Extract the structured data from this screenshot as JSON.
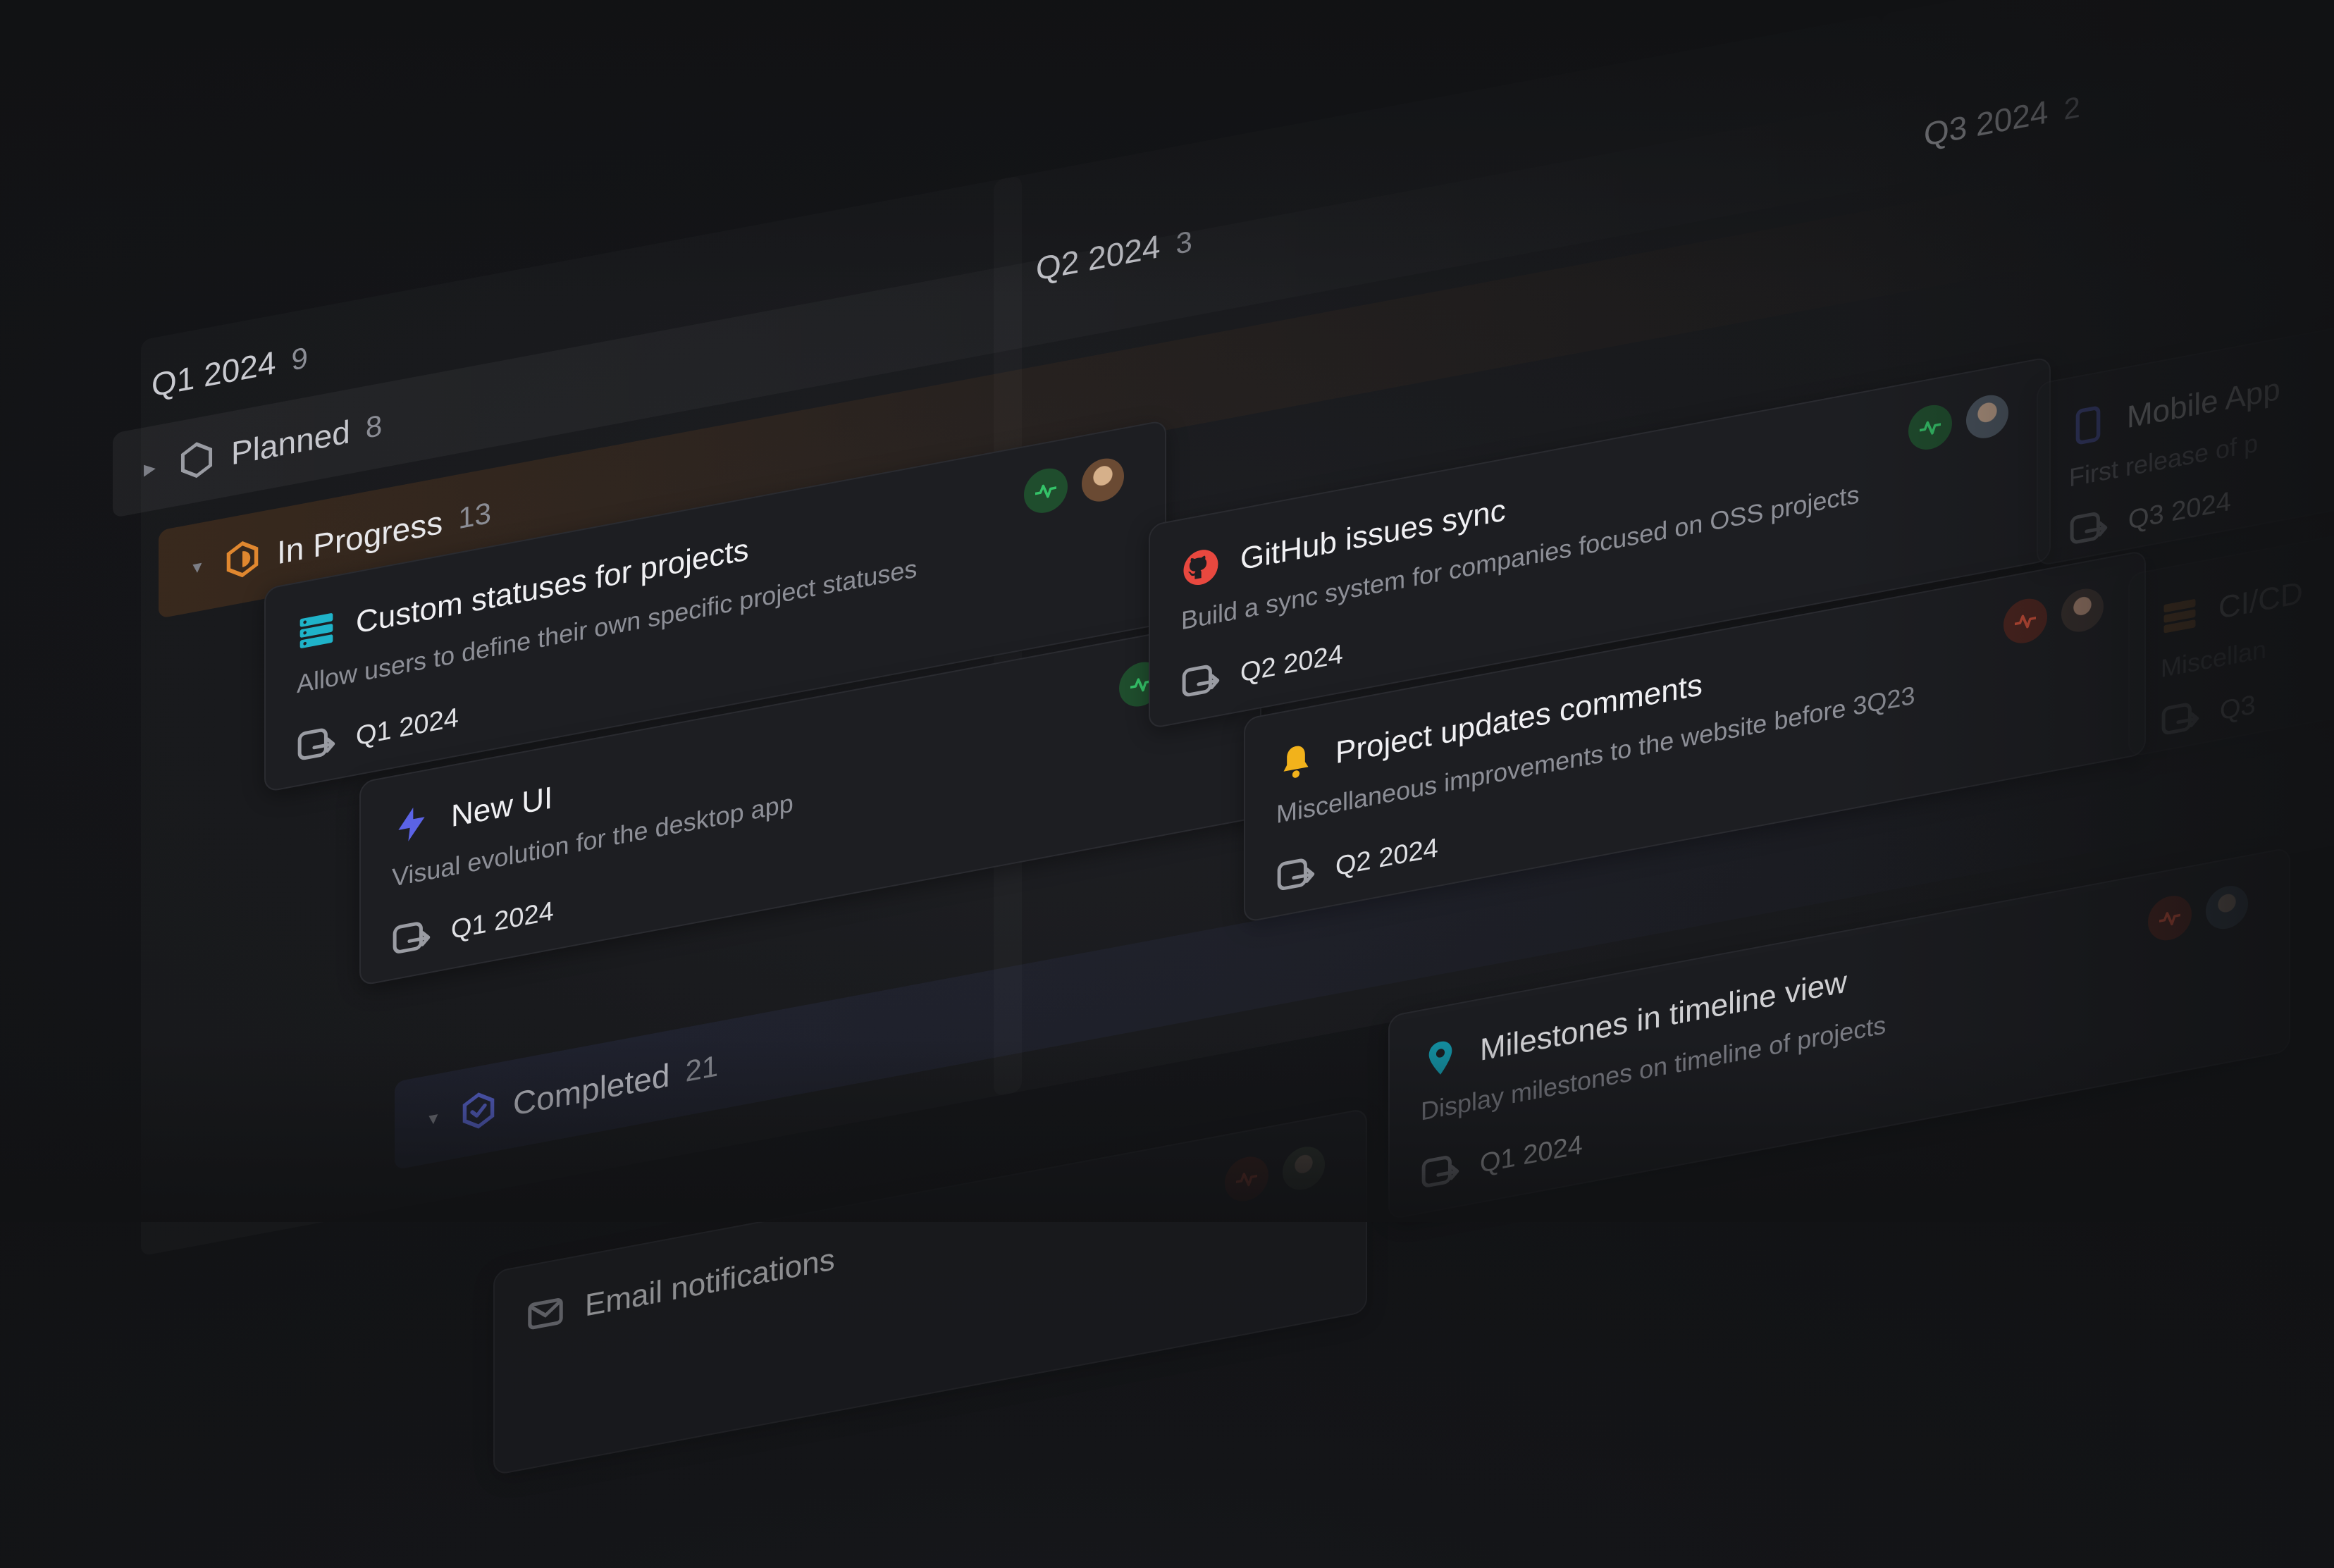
{
  "columns": [
    {
      "name": "Q1 2024",
      "count": "9"
    },
    {
      "name": "Q2 2024",
      "count": "3"
    },
    {
      "name": "Q3 2024",
      "count": "2"
    }
  ],
  "groups": {
    "planned": {
      "label": "Planned",
      "count": "8"
    },
    "in_progress": {
      "label": "In Progress",
      "count": "13"
    },
    "completed": {
      "label": "Completed",
      "count": "21"
    }
  },
  "cards": {
    "custom_statuses": {
      "title": "Custom statuses for projects",
      "description": "Allow users to define their own specific project statuses",
      "target": "Q1 2024",
      "health": "on-track"
    },
    "new_ui": {
      "title": "New UI",
      "description": "Visual evolution for the desktop app",
      "target": "Q1 2024",
      "health": "on-track"
    },
    "github_sync": {
      "title": "GitHub issues sync",
      "description": "Build a sync system for companies focused on OSS projects",
      "target": "Q2 2024",
      "health": "on-track"
    },
    "project_updates": {
      "title": "Project updates comments",
      "description": "Miscellaneous improvements to the website before 3Q23",
      "target": "Q2 2024",
      "health": "off-track"
    },
    "mobile_app": {
      "title": "Mobile App",
      "description": "First release of p",
      "target": "Q3 2024"
    },
    "cicd": {
      "title": "CI/CD",
      "description": "Miscellan",
      "target": "Q3"
    },
    "milestones": {
      "title": "Milestones in timeline view",
      "description": "Display milestones on timeline of projects",
      "target": "Q1 2024",
      "health": "off-track"
    },
    "email_notifications": {
      "title": "Email notifications",
      "health": "off-track"
    }
  },
  "colors": {
    "on_track": "#34c268",
    "off_track": "#e5553b",
    "in_progress_icon": "#e0872f",
    "completed_icon": "#5b67d8",
    "planned_icon": "#9a9ca3"
  },
  "icons": {
    "custom_statuses": "stack-icon",
    "new_ui": "lightning-icon",
    "github_sync": "github-icon",
    "project_updates": "bell-icon",
    "mobile_app": "phone-icon",
    "cicd": "stack-icon",
    "milestones": "map-pin-icon",
    "target_date": "target-date-icon"
  }
}
